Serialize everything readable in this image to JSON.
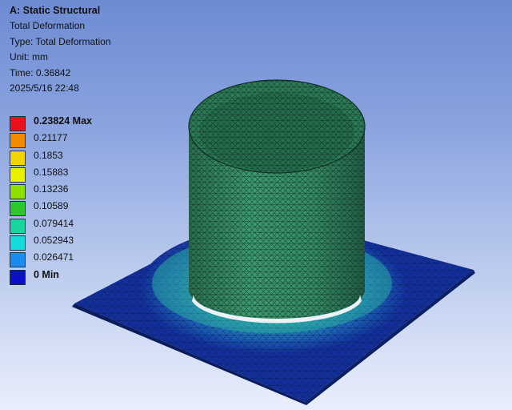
{
  "header": {
    "system": "A: Static Structural",
    "result_name": "Total Deformation",
    "type_line": "Type: Total Deformation",
    "unit_line": "Unit: mm",
    "time_line": "Time: 0.36842",
    "timestamp": "2025/5/16 22:48"
  },
  "legend": {
    "entries": [
      {
        "label": "0.23824 Max",
        "color": "#e8121a"
      },
      {
        "label": "0.21177",
        "color": "#f08a00"
      },
      {
        "label": "0.1853",
        "color": "#f2d400"
      },
      {
        "label": "0.15883",
        "color": "#e8f200"
      },
      {
        "label": "0.13236",
        "color": "#8ee000"
      },
      {
        "label": "0.10589",
        "color": "#2ec82a"
      },
      {
        "label": "0.079414",
        "color": "#19d49c"
      },
      {
        "label": "0.052943",
        "color": "#14dcdc"
      },
      {
        "label": "0.026471",
        "color": "#1a8cf0"
      },
      {
        "label": "0 Min",
        "color": "#0a10c8"
      }
    ]
  },
  "colors": {
    "cylinder": "#2f7a58",
    "cylinder_mesh": "#0f2e24",
    "plate_outer": "#0f2a8c",
    "plate_mid": "#1f6fae",
    "plate_inner": "#2aa2a0",
    "gap": "#e9eef5"
  }
}
